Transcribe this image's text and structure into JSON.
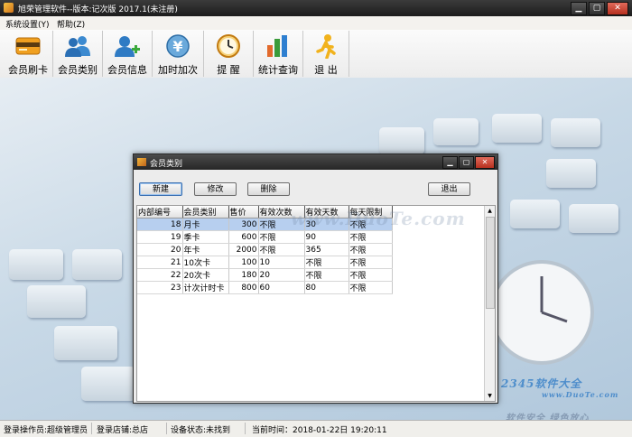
{
  "window": {
    "title": "旭荣管理软件--版本:记次版 2017.1(未注册)",
    "controls": {
      "minimize": "▁",
      "maximize": "▢",
      "close": "✕"
    }
  },
  "menu": [
    {
      "label": "系统设置(Y)"
    },
    {
      "label": "帮助(Z)"
    }
  ],
  "toolbar": [
    {
      "label": "会员刷卡",
      "icon": "card-icon"
    },
    {
      "label": "会员类别",
      "icon": "users-icon"
    },
    {
      "label": "会员信息",
      "icon": "add-user-icon"
    },
    {
      "label": "加时加次",
      "icon": "yen-icon"
    },
    {
      "label": "提 醒",
      "icon": "clock-icon"
    },
    {
      "label": "统计查询",
      "icon": "bar-chart-icon"
    },
    {
      "label": "退 出",
      "icon": "exit-person-icon"
    }
  ],
  "dialog": {
    "title": "会员类别",
    "buttons": {
      "new": "新建",
      "edit": "修改",
      "delete": "删除",
      "exit": "退出"
    },
    "columns": [
      "内部编号",
      "会员类别",
      "售价",
      "有效次数",
      "有效天数",
      "每天限制"
    ],
    "rows": [
      {
        "id": "18",
        "type": "月卡",
        "price": "300",
        "times": "不限",
        "days": "30",
        "limit": "不限",
        "selected": true
      },
      {
        "id": "19",
        "type": "季卡",
        "price": "600",
        "times": "不限",
        "days": "90",
        "limit": "不限",
        "selected": false
      },
      {
        "id": "20",
        "type": "年卡",
        "price": "2000",
        "times": "不限",
        "days": "365",
        "limit": "不限",
        "selected": false
      },
      {
        "id": "21",
        "type": "10次卡",
        "price": "100",
        "times": "10",
        "days": "不限",
        "limit": "不限",
        "selected": false
      },
      {
        "id": "22",
        "type": "20次卡",
        "price": "180",
        "times": "20",
        "days": "不限",
        "limit": "不限",
        "selected": false
      },
      {
        "id": "23",
        "type": "计次计时卡",
        "price": "800",
        "times": "60",
        "days": "80",
        "limit": "不限",
        "selected": false
      }
    ],
    "watermark": "www.DuoTe.com"
  },
  "watermarks": {
    "site": "2345软件大全",
    "site_url": "www.DuoTe.com",
    "partial": "软件安全 绿色放心"
  },
  "status": {
    "operator": "登录操作员:超级管理员",
    "store": "登录店铺:总店",
    "device": "设备状态:未找到",
    "time": "当前时间：2018-01-22日 19:20:11"
  },
  "colors": {
    "selected_row": "#b7cfef",
    "titlebar": "#262626",
    "close_button": "#c8402e"
  }
}
